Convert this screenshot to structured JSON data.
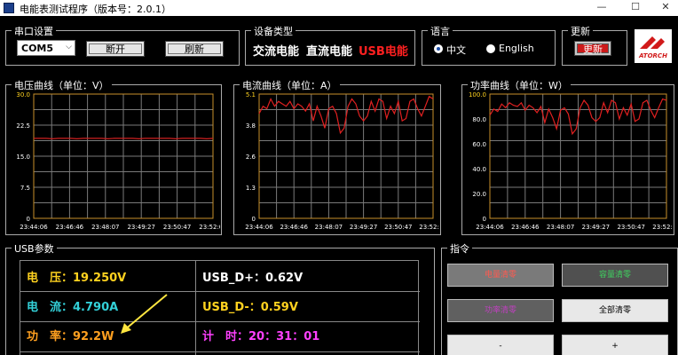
{
  "window": {
    "title": "电能表测试程序（版本号：2.0.1）",
    "controls": {
      "minimize": "—",
      "maximize": "☐",
      "close": "✕"
    }
  },
  "serial": {
    "group_label": "串口设置",
    "port_value": "COM5",
    "disconnect_label": "断开",
    "refresh_label": "刷新"
  },
  "device_type": {
    "group_label": "设备类型",
    "items": [
      {
        "label": "交流电能",
        "color": "#ffffff"
      },
      {
        "label": "直流电能",
        "color": "#ffffff"
      },
      {
        "label": "USB电能",
        "color": "#ff2020"
      }
    ]
  },
  "language": {
    "group_label": "语言",
    "options": [
      {
        "label": "中文",
        "selected": true
      },
      {
        "label": "English",
        "selected": false
      }
    ]
  },
  "update": {
    "group_label": "更新",
    "button_label": "更新",
    "logo_text": "ATORCH"
  },
  "chart_data": [
    {
      "type": "line",
      "title": "电压曲线（单位：V）",
      "x_ticks": [
        "23:44:06",
        "23:46:46",
        "23:48:07",
        "23:49:27",
        "23:50:47",
        "23:52:09"
      ],
      "y_ticks": [
        "30.0",
        "22.5",
        "15.0",
        "7.5",
        "0"
      ],
      "ylim": [
        0,
        30
      ],
      "grid": true,
      "series": [
        {
          "color": "#d02020",
          "values": [
            19.3,
            19.3,
            19.3,
            19.2,
            19.3,
            19.3,
            19.3,
            19.2,
            19.3,
            19.3,
            19.3,
            19.3,
            19.2,
            19.3,
            19.3,
            19.3,
            19.3,
            19.2,
            19.3,
            19.3,
            19.3,
            19.3,
            19.3,
            19.2,
            19.3,
            19.3,
            19.3,
            19.3,
            19.2,
            19.3
          ]
        }
      ]
    },
    {
      "type": "line",
      "title": "电流曲线（单位：A）",
      "x_ticks": [
        "23:44:06",
        "23:46:46",
        "23:48:07",
        "23:49:27",
        "23:50:47",
        "23:52:09"
      ],
      "y_ticks": [
        "5.1",
        "3.8",
        "2.6",
        "1.3",
        "0"
      ],
      "ylim": [
        0,
        5.1
      ],
      "grid": true,
      "series": [
        {
          "color": "#e02020",
          "values": [
            4.3,
            4.6,
            4.5,
            4.9,
            4.6,
            4.8,
            4.7,
            4.6,
            4.8,
            4.5,
            4.7,
            4.6,
            4.4,
            4.7,
            4.0,
            4.6,
            4.2,
            3.7,
            4.5,
            4.6,
            4.3,
            3.5,
            3.7,
            4.6,
            4.9,
            4.7,
            4.2,
            4.0,
            4.2,
            4.8,
            4.4,
            4.9,
            4.8,
            4.1,
            4.6,
            4.3,
            4.8,
            4.0,
            4.1,
            4.8,
            4.9,
            4.5,
            4.2,
            4.6,
            5.0,
            4.9
          ]
        }
      ]
    },
    {
      "type": "line",
      "title": "功率曲线（单位：W）",
      "x_ticks": [
        "23:44:06",
        "23:46:46",
        "23:48:07",
        "23:49:27",
        "23:50:47",
        "23:52:09"
      ],
      "y_ticks": [
        "100.0",
        "80.0",
        "60.0",
        "40.0",
        "20.0",
        "0"
      ],
      "ylim": [
        0,
        100
      ],
      "grid": true,
      "series": [
        {
          "color": "#e02020",
          "values": [
            83,
            88,
            86,
            92,
            89,
            93,
            91,
            90,
            93,
            87,
            91,
            89,
            85,
            90,
            77,
            88,
            81,
            72,
            87,
            89,
            84,
            68,
            72,
            89,
            95,
            91,
            81,
            78,
            81,
            93,
            85,
            95,
            93,
            80,
            89,
            83,
            92,
            78,
            80,
            93,
            95,
            87,
            81,
            89,
            96,
            95
          ]
        }
      ]
    }
  ],
  "usb": {
    "group_label": "USB参数",
    "cells": [
      {
        "label": "电　压：",
        "value": "19.250V",
        "color": "#ffd21f"
      },
      {
        "label": "USB_D+：",
        "value": "0.62V",
        "color": "#ffffff"
      },
      {
        "label": "电　流：",
        "value": "4.790A",
        "color": "#33d0d8"
      },
      {
        "label": "USB_D-：",
        "value": "0.59V",
        "color": "#ffd21f"
      },
      {
        "label": "功　率：",
        "value": "92.2W",
        "color": "#ffa020"
      },
      {
        "label": "计　时：",
        "value": "20：31：01",
        "color": "#ff40ff"
      }
    ]
  },
  "commands": {
    "group_label": "指令",
    "buttons": [
      {
        "label": "电量清零",
        "bg": "#7a7a7a",
        "color": "#ff5a50"
      },
      {
        "label": "容量清零",
        "bg": "#505050",
        "color": "#3fcf5f"
      },
      {
        "label": "功率清零",
        "bg": "#606060",
        "color": "#c040c0"
      },
      {
        "label": "全部清零",
        "bg": "#e8e8e8",
        "color": "#000000"
      },
      {
        "label": "-",
        "bg": "#e8e8e8",
        "color": "#000000"
      },
      {
        "label": "+",
        "bg": "#e8e8e8",
        "color": "#000000"
      }
    ]
  },
  "colors": {
    "background": "#000000",
    "grid": "#7a7a7a",
    "frame": "#c8902a",
    "accent_red": "#ff2020"
  }
}
